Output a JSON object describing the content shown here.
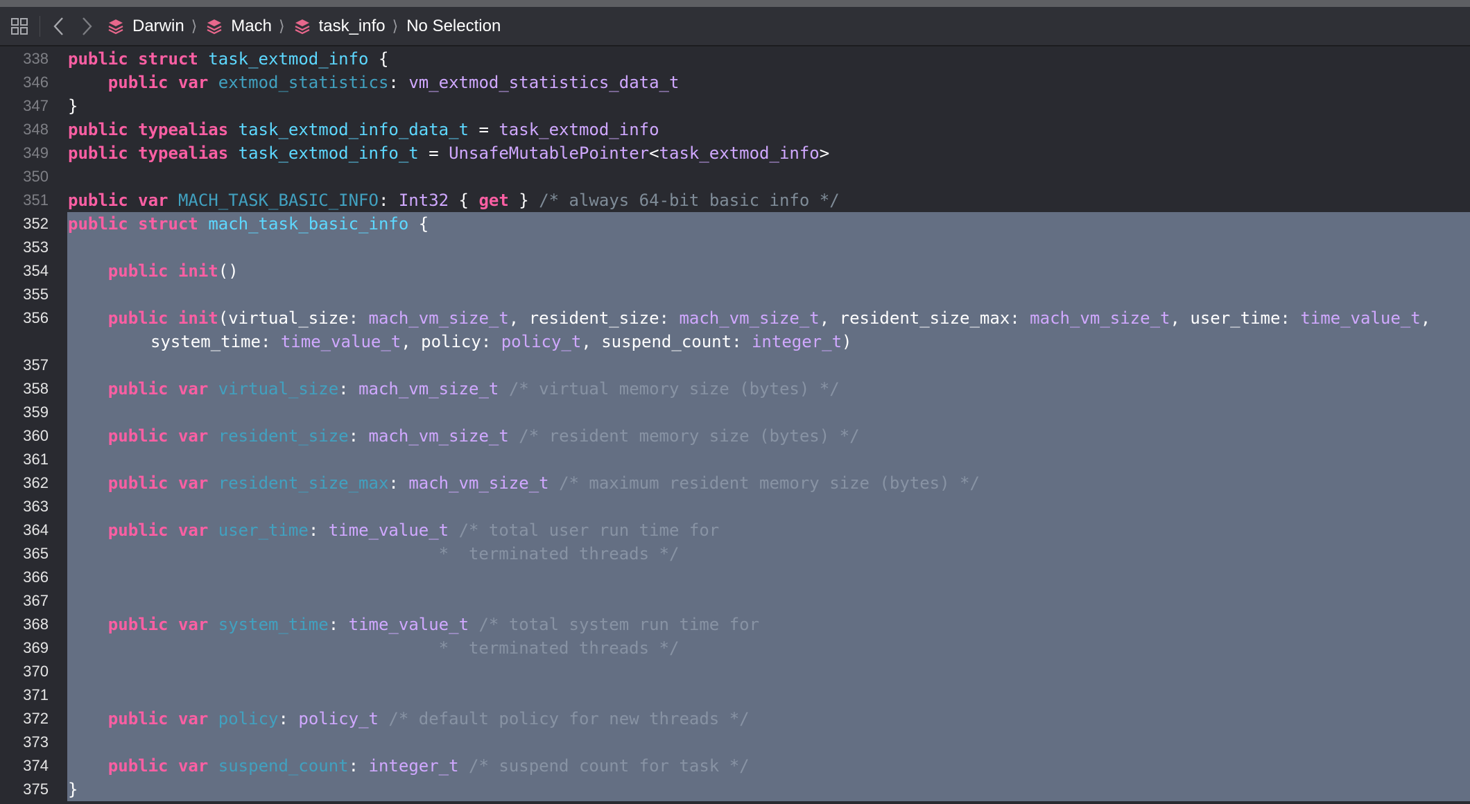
{
  "window": {
    "colors": {
      "background": "#292a30",
      "selection": "#646f83",
      "keyword": "#fc5fa3",
      "type": "#d0a8ff",
      "declaration": "#5dd8ff",
      "property": "#41a1c0",
      "comment": "#7f8c98"
    }
  },
  "jumpbar": {
    "icons": {
      "grid": "grid-icon",
      "back": "chevron-left-icon",
      "forward": "chevron-right-icon",
      "module": "module-stack-icon"
    },
    "breadcrumbs": [
      {
        "label": "Darwin"
      },
      {
        "label": "Mach"
      },
      {
        "label": "task_info"
      }
    ],
    "selection_label": "No Selection"
  },
  "editor": {
    "lines": [
      {
        "n": "338",
        "t": [
          {
            "k": "kw",
            "s": "public"
          },
          {
            "s": " "
          },
          {
            "k": "kw",
            "s": "struct"
          },
          {
            "s": " "
          },
          {
            "k": "decl",
            "s": "task_extmod_info"
          },
          {
            "s": " {"
          }
        ]
      },
      {
        "n": "346",
        "t": [
          {
            "s": "    "
          },
          {
            "k": "kw",
            "s": "public"
          },
          {
            "s": " "
          },
          {
            "k": "kw",
            "s": "var"
          },
          {
            "s": " "
          },
          {
            "k": "prop",
            "s": "extmod_statistics"
          },
          {
            "s": ": "
          },
          {
            "k": "ty",
            "s": "vm_extmod_statistics_data_t"
          }
        ]
      },
      {
        "n": "347",
        "t": [
          {
            "s": "}"
          }
        ]
      },
      {
        "n": "348",
        "t": [
          {
            "k": "kw",
            "s": "public"
          },
          {
            "s": " "
          },
          {
            "k": "kw",
            "s": "typealias"
          },
          {
            "s": " "
          },
          {
            "k": "decl",
            "s": "task_extmod_info_data_t"
          },
          {
            "s": " = "
          },
          {
            "k": "ty",
            "s": "task_extmod_info"
          }
        ]
      },
      {
        "n": "349",
        "t": [
          {
            "k": "kw",
            "s": "public"
          },
          {
            "s": " "
          },
          {
            "k": "kw",
            "s": "typealias"
          },
          {
            "s": " "
          },
          {
            "k": "decl",
            "s": "task_extmod_info_t"
          },
          {
            "s": " = "
          },
          {
            "k": "ty",
            "s": "UnsafeMutablePointer"
          },
          {
            "s": "<"
          },
          {
            "k": "ty",
            "s": "task_extmod_info"
          },
          {
            "s": ">"
          }
        ]
      },
      {
        "n": "350",
        "t": []
      },
      {
        "n": "351",
        "t": [
          {
            "k": "kw",
            "s": "public"
          },
          {
            "s": " "
          },
          {
            "k": "kw",
            "s": "var"
          },
          {
            "s": " "
          },
          {
            "k": "prop",
            "s": "MACH_TASK_BASIC_INFO"
          },
          {
            "s": ": "
          },
          {
            "k": "ty",
            "s": "Int32"
          },
          {
            "s": " { "
          },
          {
            "k": "kw",
            "s": "get"
          },
          {
            "s": " } "
          },
          {
            "k": "cm",
            "s": "/* always 64-bit basic info */"
          }
        ]
      },
      {
        "n": "352",
        "sel": true,
        "t": [
          {
            "k": "kw",
            "s": "public"
          },
          {
            "s": " "
          },
          {
            "k": "kw",
            "s": "struct"
          },
          {
            "s": " "
          },
          {
            "k": "decl",
            "s": "mach_task_basic_info"
          },
          {
            "s": " {"
          }
        ]
      },
      {
        "n": "353",
        "sel": true,
        "t": []
      },
      {
        "n": "354",
        "sel": true,
        "t": [
          {
            "s": "    "
          },
          {
            "k": "kw",
            "s": "public"
          },
          {
            "s": " "
          },
          {
            "k": "kw",
            "s": "init"
          },
          {
            "s": "()"
          }
        ]
      },
      {
        "n": "355",
        "sel": true,
        "t": []
      },
      {
        "n": "356",
        "sel": true,
        "wrap": true,
        "t": [
          {
            "s": "    "
          },
          {
            "k": "kw",
            "s": "public"
          },
          {
            "s": " "
          },
          {
            "k": "kw",
            "s": "init"
          },
          {
            "s": "(virtual_size: "
          },
          {
            "k": "ty",
            "s": "mach_vm_size_t"
          },
          {
            "s": ", resident_size: "
          },
          {
            "k": "ty",
            "s": "mach_vm_size_t"
          },
          {
            "s": ", resident_size_max: "
          },
          {
            "k": "ty",
            "s": "mach_vm_size_t"
          },
          {
            "s": ", user_time: "
          },
          {
            "k": "ty",
            "s": "time_value_t"
          },
          {
            "s": ","
          }
        ],
        "t2": [
          {
            "s": "system_time: "
          },
          {
            "k": "ty",
            "s": "time_value_t"
          },
          {
            "s": ", policy: "
          },
          {
            "k": "ty",
            "s": "policy_t"
          },
          {
            "s": ", suspend_count: "
          },
          {
            "k": "ty",
            "s": "integer_t"
          },
          {
            "s": ")"
          }
        ]
      },
      {
        "n": "357",
        "sel": true,
        "t": []
      },
      {
        "n": "358",
        "sel": true,
        "t": [
          {
            "s": "    "
          },
          {
            "k": "kw",
            "s": "public"
          },
          {
            "s": " "
          },
          {
            "k": "kw",
            "s": "var"
          },
          {
            "s": " "
          },
          {
            "k": "prop",
            "s": "virtual_size"
          },
          {
            "s": ": "
          },
          {
            "k": "ty",
            "s": "mach_vm_size_t"
          },
          {
            "s": " "
          },
          {
            "k": "cm",
            "s": "/* virtual memory size (bytes) */"
          }
        ]
      },
      {
        "n": "359",
        "sel": true,
        "t": []
      },
      {
        "n": "360",
        "sel": true,
        "t": [
          {
            "s": "    "
          },
          {
            "k": "kw",
            "s": "public"
          },
          {
            "s": " "
          },
          {
            "k": "kw",
            "s": "var"
          },
          {
            "s": " "
          },
          {
            "k": "prop",
            "s": "resident_size"
          },
          {
            "s": ": "
          },
          {
            "k": "ty",
            "s": "mach_vm_size_t"
          },
          {
            "s": " "
          },
          {
            "k": "cm",
            "s": "/* resident memory size (bytes) */"
          }
        ]
      },
      {
        "n": "361",
        "sel": true,
        "t": []
      },
      {
        "n": "362",
        "sel": true,
        "t": [
          {
            "s": "    "
          },
          {
            "k": "kw",
            "s": "public"
          },
          {
            "s": " "
          },
          {
            "k": "kw",
            "s": "var"
          },
          {
            "s": " "
          },
          {
            "k": "prop",
            "s": "resident_size_max"
          },
          {
            "s": ": "
          },
          {
            "k": "ty",
            "s": "mach_vm_size_t"
          },
          {
            "s": " "
          },
          {
            "k": "cm",
            "s": "/* maximum resident memory size (bytes) */"
          }
        ]
      },
      {
        "n": "363",
        "sel": true,
        "t": []
      },
      {
        "n": "364",
        "sel": true,
        "t": [
          {
            "s": "    "
          },
          {
            "k": "kw",
            "s": "public"
          },
          {
            "s": " "
          },
          {
            "k": "kw",
            "s": "var"
          },
          {
            "s": " "
          },
          {
            "k": "prop",
            "s": "user_time"
          },
          {
            "s": ": "
          },
          {
            "k": "ty",
            "s": "time_value_t"
          },
          {
            "s": " "
          },
          {
            "k": "cm",
            "s": "/* total user run time for"
          }
        ]
      },
      {
        "n": "365",
        "sel": true,
        "t": [
          {
            "s": "                                     "
          },
          {
            "k": "cm",
            "s": "*  terminated threads */"
          }
        ]
      },
      {
        "n": "366",
        "sel": true,
        "t": []
      },
      {
        "n": "367",
        "sel": true,
        "t": []
      },
      {
        "n": "368",
        "sel": true,
        "t": [
          {
            "s": "    "
          },
          {
            "k": "kw",
            "s": "public"
          },
          {
            "s": " "
          },
          {
            "k": "kw",
            "s": "var"
          },
          {
            "s": " "
          },
          {
            "k": "prop",
            "s": "system_time"
          },
          {
            "s": ": "
          },
          {
            "k": "ty",
            "s": "time_value_t"
          },
          {
            "s": " "
          },
          {
            "k": "cm",
            "s": "/* total system run time for"
          }
        ]
      },
      {
        "n": "369",
        "sel": true,
        "t": [
          {
            "s": "                                     "
          },
          {
            "k": "cm",
            "s": "*  terminated threads */"
          }
        ]
      },
      {
        "n": "370",
        "sel": true,
        "t": []
      },
      {
        "n": "371",
        "sel": true,
        "t": []
      },
      {
        "n": "372",
        "sel": true,
        "t": [
          {
            "s": "    "
          },
          {
            "k": "kw",
            "s": "public"
          },
          {
            "s": " "
          },
          {
            "k": "kw",
            "s": "var"
          },
          {
            "s": " "
          },
          {
            "k": "prop",
            "s": "policy"
          },
          {
            "s": ": "
          },
          {
            "k": "ty",
            "s": "policy_t"
          },
          {
            "s": " "
          },
          {
            "k": "cm",
            "s": "/* default policy for new threads */"
          }
        ]
      },
      {
        "n": "373",
        "sel": true,
        "t": []
      },
      {
        "n": "374",
        "sel": true,
        "t": [
          {
            "s": "    "
          },
          {
            "k": "kw",
            "s": "public"
          },
          {
            "s": " "
          },
          {
            "k": "kw",
            "s": "var"
          },
          {
            "s": " "
          },
          {
            "k": "prop",
            "s": "suspend_count"
          },
          {
            "s": ": "
          },
          {
            "k": "ty",
            "s": "integer_t"
          },
          {
            "s": " "
          },
          {
            "k": "cm",
            "s": "/* suspend count for task */"
          }
        ]
      },
      {
        "n": "375",
        "sel": true,
        "t": [
          {
            "s": "}"
          }
        ]
      }
    ]
  }
}
